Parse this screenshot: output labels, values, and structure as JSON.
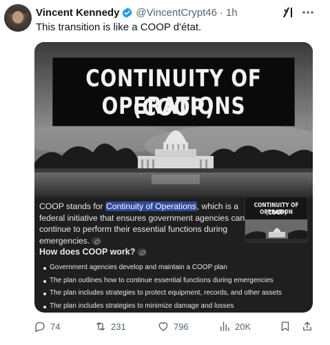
{
  "author": {
    "display_name": "Vincent Kennedy",
    "handle": "@VincentCrypt46",
    "separator": "·",
    "time": "1h",
    "verified": true
  },
  "tweet_text": "This transition is like a COOP d'état.",
  "card": {
    "image_title_line1": "CONTINUITY OF OPERATIONS",
    "image_title_line2": "(COOP)",
    "summary_before": "COOP stands for ",
    "summary_highlight": "Continuity of Operations",
    "summary_after": ", which is a federal initiative that ensures government agencies can continue to perform their essential functions during emergencies.",
    "thumbnail_title_line1": "CONTINUITY OF OPERATION",
    "thumbnail_title_line2": "(COOP)",
    "how_heading": "How does COOP work?",
    "bullets": [
      "Government agencies develop and maintain a COOP plan",
      "The plan outlines how to continue essential functions during emergencies",
      "The plan includes strategies to protect equipment, records, and other assets",
      "The plan includes strategies to minimize damage and losses"
    ]
  },
  "actions": {
    "replies": "74",
    "reposts": "231",
    "likes": "796",
    "views": "20K"
  },
  "icons": {
    "verified": "verified-badge-icon",
    "grok": "grok-icon",
    "more": "more-icon",
    "reply": "reply-icon",
    "repost": "repost-icon",
    "like": "heart-icon",
    "views": "views-icon",
    "bookmark": "bookmark-icon",
    "share": "share-icon"
  },
  "colors": {
    "verified_blue": "#1d9bf0",
    "secondary_text": "#536471",
    "card_background": "#1f1f1f",
    "highlight": "#2f4a9a"
  }
}
